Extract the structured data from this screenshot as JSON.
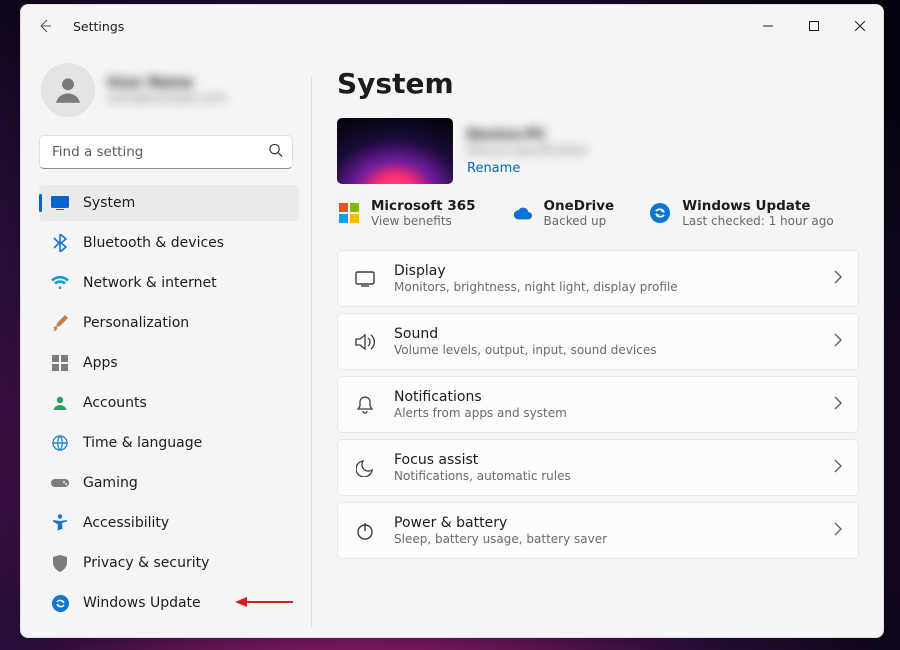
{
  "window": {
    "title": "Settings"
  },
  "profile": {
    "name": "User Name",
    "email": "user@example.com"
  },
  "search": {
    "placeholder": "Find a setting"
  },
  "sidebar": {
    "items": [
      {
        "label": "System"
      },
      {
        "label": "Bluetooth & devices"
      },
      {
        "label": "Network & internet"
      },
      {
        "label": "Personalization"
      },
      {
        "label": "Apps"
      },
      {
        "label": "Accounts"
      },
      {
        "label": "Time & language"
      },
      {
        "label": "Gaming"
      },
      {
        "label": "Accessibility"
      },
      {
        "label": "Privacy & security"
      },
      {
        "label": "Windows Update"
      }
    ],
    "active_index": 0,
    "highlight_arrow_index": 10
  },
  "header": {
    "title": "System"
  },
  "device": {
    "name": "Device-PC",
    "sub": "Device specification",
    "rename_label": "Rename"
  },
  "cloud": {
    "m365": {
      "title": "Microsoft 365",
      "sub": "View benefits"
    },
    "onedrive": {
      "title": "OneDrive",
      "sub": "Backed up"
    },
    "update": {
      "title": "Windows Update",
      "sub": "Last checked: 1 hour ago"
    }
  },
  "cards": [
    {
      "title": "Display",
      "sub": "Monitors, brightness, night light, display profile"
    },
    {
      "title": "Sound",
      "sub": "Volume levels, output, input, sound devices"
    },
    {
      "title": "Notifications",
      "sub": "Alerts from apps and system"
    },
    {
      "title": "Focus assist",
      "sub": "Notifications, automatic rules"
    },
    {
      "title": "Power & battery",
      "sub": "Sleep, battery usage, battery saver"
    }
  ]
}
